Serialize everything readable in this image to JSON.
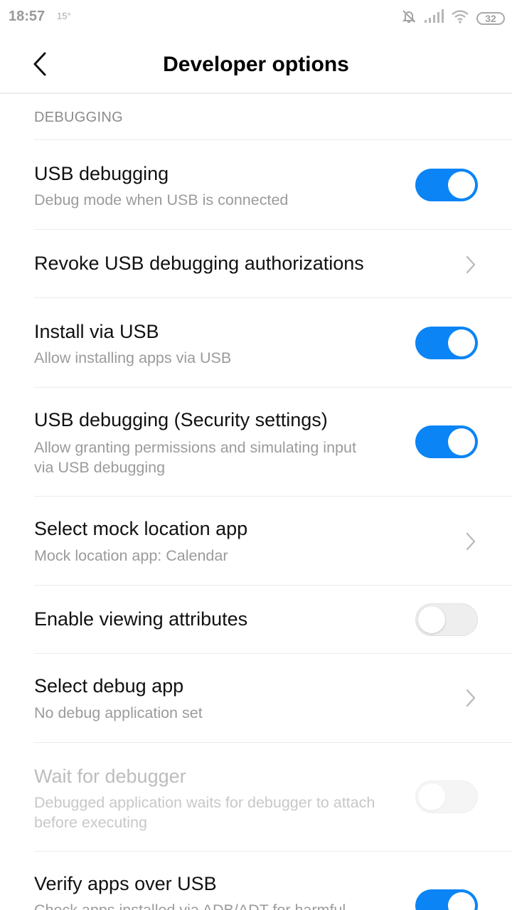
{
  "status_bar": {
    "time": "18:57",
    "temperature": "15°",
    "battery": "32"
  },
  "header": {
    "title": "Developer options"
  },
  "section": {
    "label": "DEBUGGING"
  },
  "items": [
    {
      "title": "USB debugging",
      "subtitle": "Debug mode when USB is connected",
      "control": "toggle",
      "state": "on",
      "enabled": true
    },
    {
      "title": "Revoke USB debugging authorizations",
      "control": "chevron",
      "enabled": true
    },
    {
      "title": "Install via USB",
      "subtitle": "Allow installing apps via USB",
      "control": "toggle",
      "state": "on",
      "enabled": true
    },
    {
      "title": "USB debugging (Security settings)",
      "subtitle": "Allow granting permissions and simulating input via USB debugging",
      "control": "toggle",
      "state": "on",
      "enabled": true
    },
    {
      "title": "Select mock location app",
      "subtitle": "Mock location app: Calendar",
      "control": "chevron",
      "enabled": true
    },
    {
      "title": "Enable viewing attributes",
      "control": "toggle",
      "state": "off",
      "enabled": true
    },
    {
      "title": "Select debug app",
      "subtitle": "No debug application set",
      "control": "chevron",
      "enabled": true
    },
    {
      "title": "Wait for debugger",
      "subtitle": "Debugged application waits for debugger to attach before executing",
      "control": "toggle",
      "state": "off",
      "enabled": false
    },
    {
      "title": "Verify apps over USB",
      "subtitle": "Check apps installed via ADB/ADT for harmful",
      "control": "toggle",
      "state": "on",
      "enabled": true
    }
  ],
  "colors": {
    "accent": "#0b84f5",
    "divider": "#ececec"
  }
}
